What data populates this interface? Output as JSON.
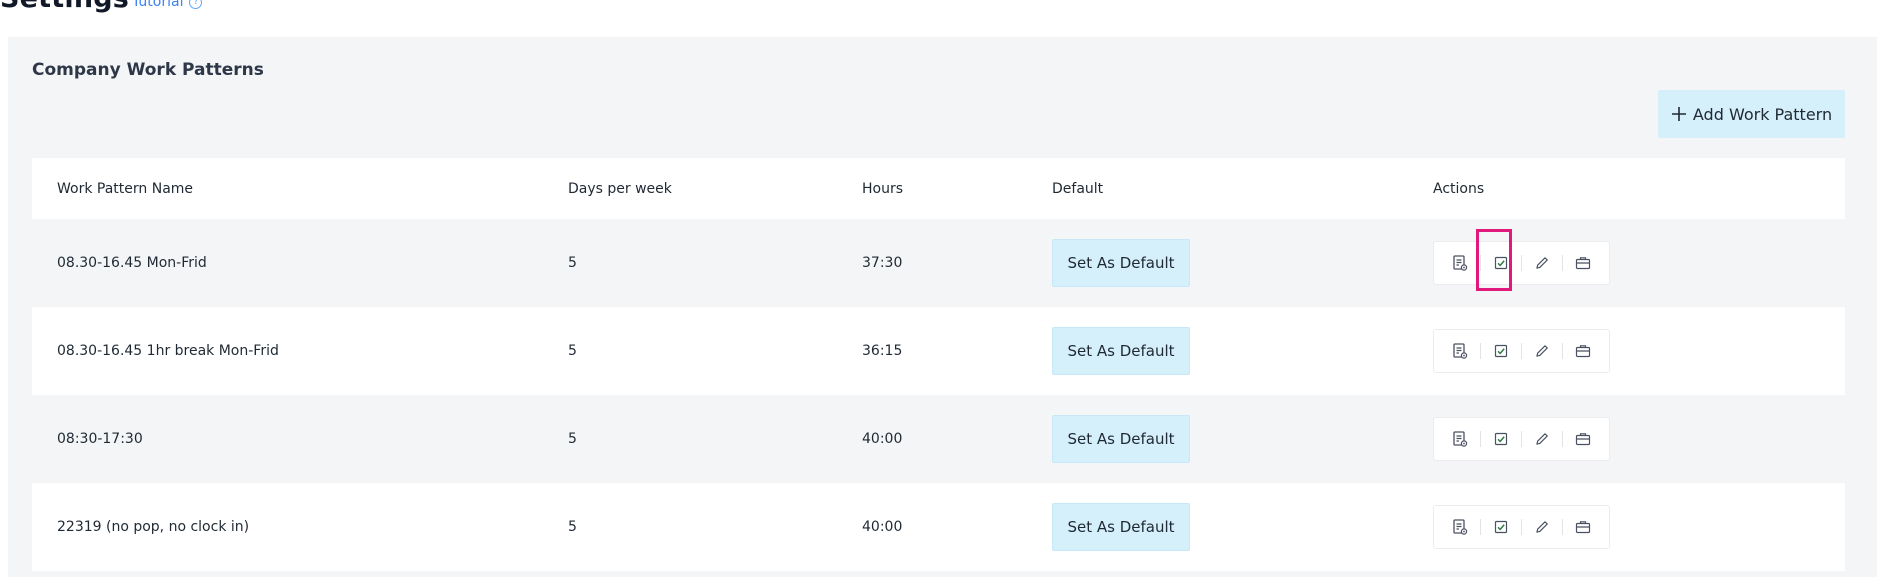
{
  "header": {
    "title": "Settings",
    "tutorial_label": "Tutorial",
    "help_glyph": "?"
  },
  "panel": {
    "title": "Company Work Patterns",
    "add_button_label": "Add Work Pattern"
  },
  "table": {
    "columns": [
      "Work Pattern Name",
      "Days per week",
      "Hours",
      "Default",
      "Actions"
    ],
    "rows": [
      {
        "name": "08.30-16.45 Mon-Frid",
        "days": "5",
        "hours": "37:30",
        "default_label": "Set As Default"
      },
      {
        "name": "08.30-16.45 1hr break Mon-Frid",
        "days": "5",
        "hours": "36:15",
        "default_label": "Set As Default"
      },
      {
        "name": "08:30-17:30",
        "days": "5",
        "hours": "40:00",
        "default_label": "Set As Default"
      },
      {
        "name": "22319 (no pop, no clock in)",
        "days": "5",
        "hours": "40:00",
        "default_label": "Set As Default"
      }
    ],
    "action_icons": [
      "view-document-icon",
      "checkbox-icon",
      "edit-pencil-icon",
      "briefcase-icon"
    ]
  },
  "colors": {
    "accent_button": "#d6f0fb",
    "highlight": "#e0197b",
    "check_green": "#2f7d46",
    "panel_bg": "#f4f5f7"
  }
}
